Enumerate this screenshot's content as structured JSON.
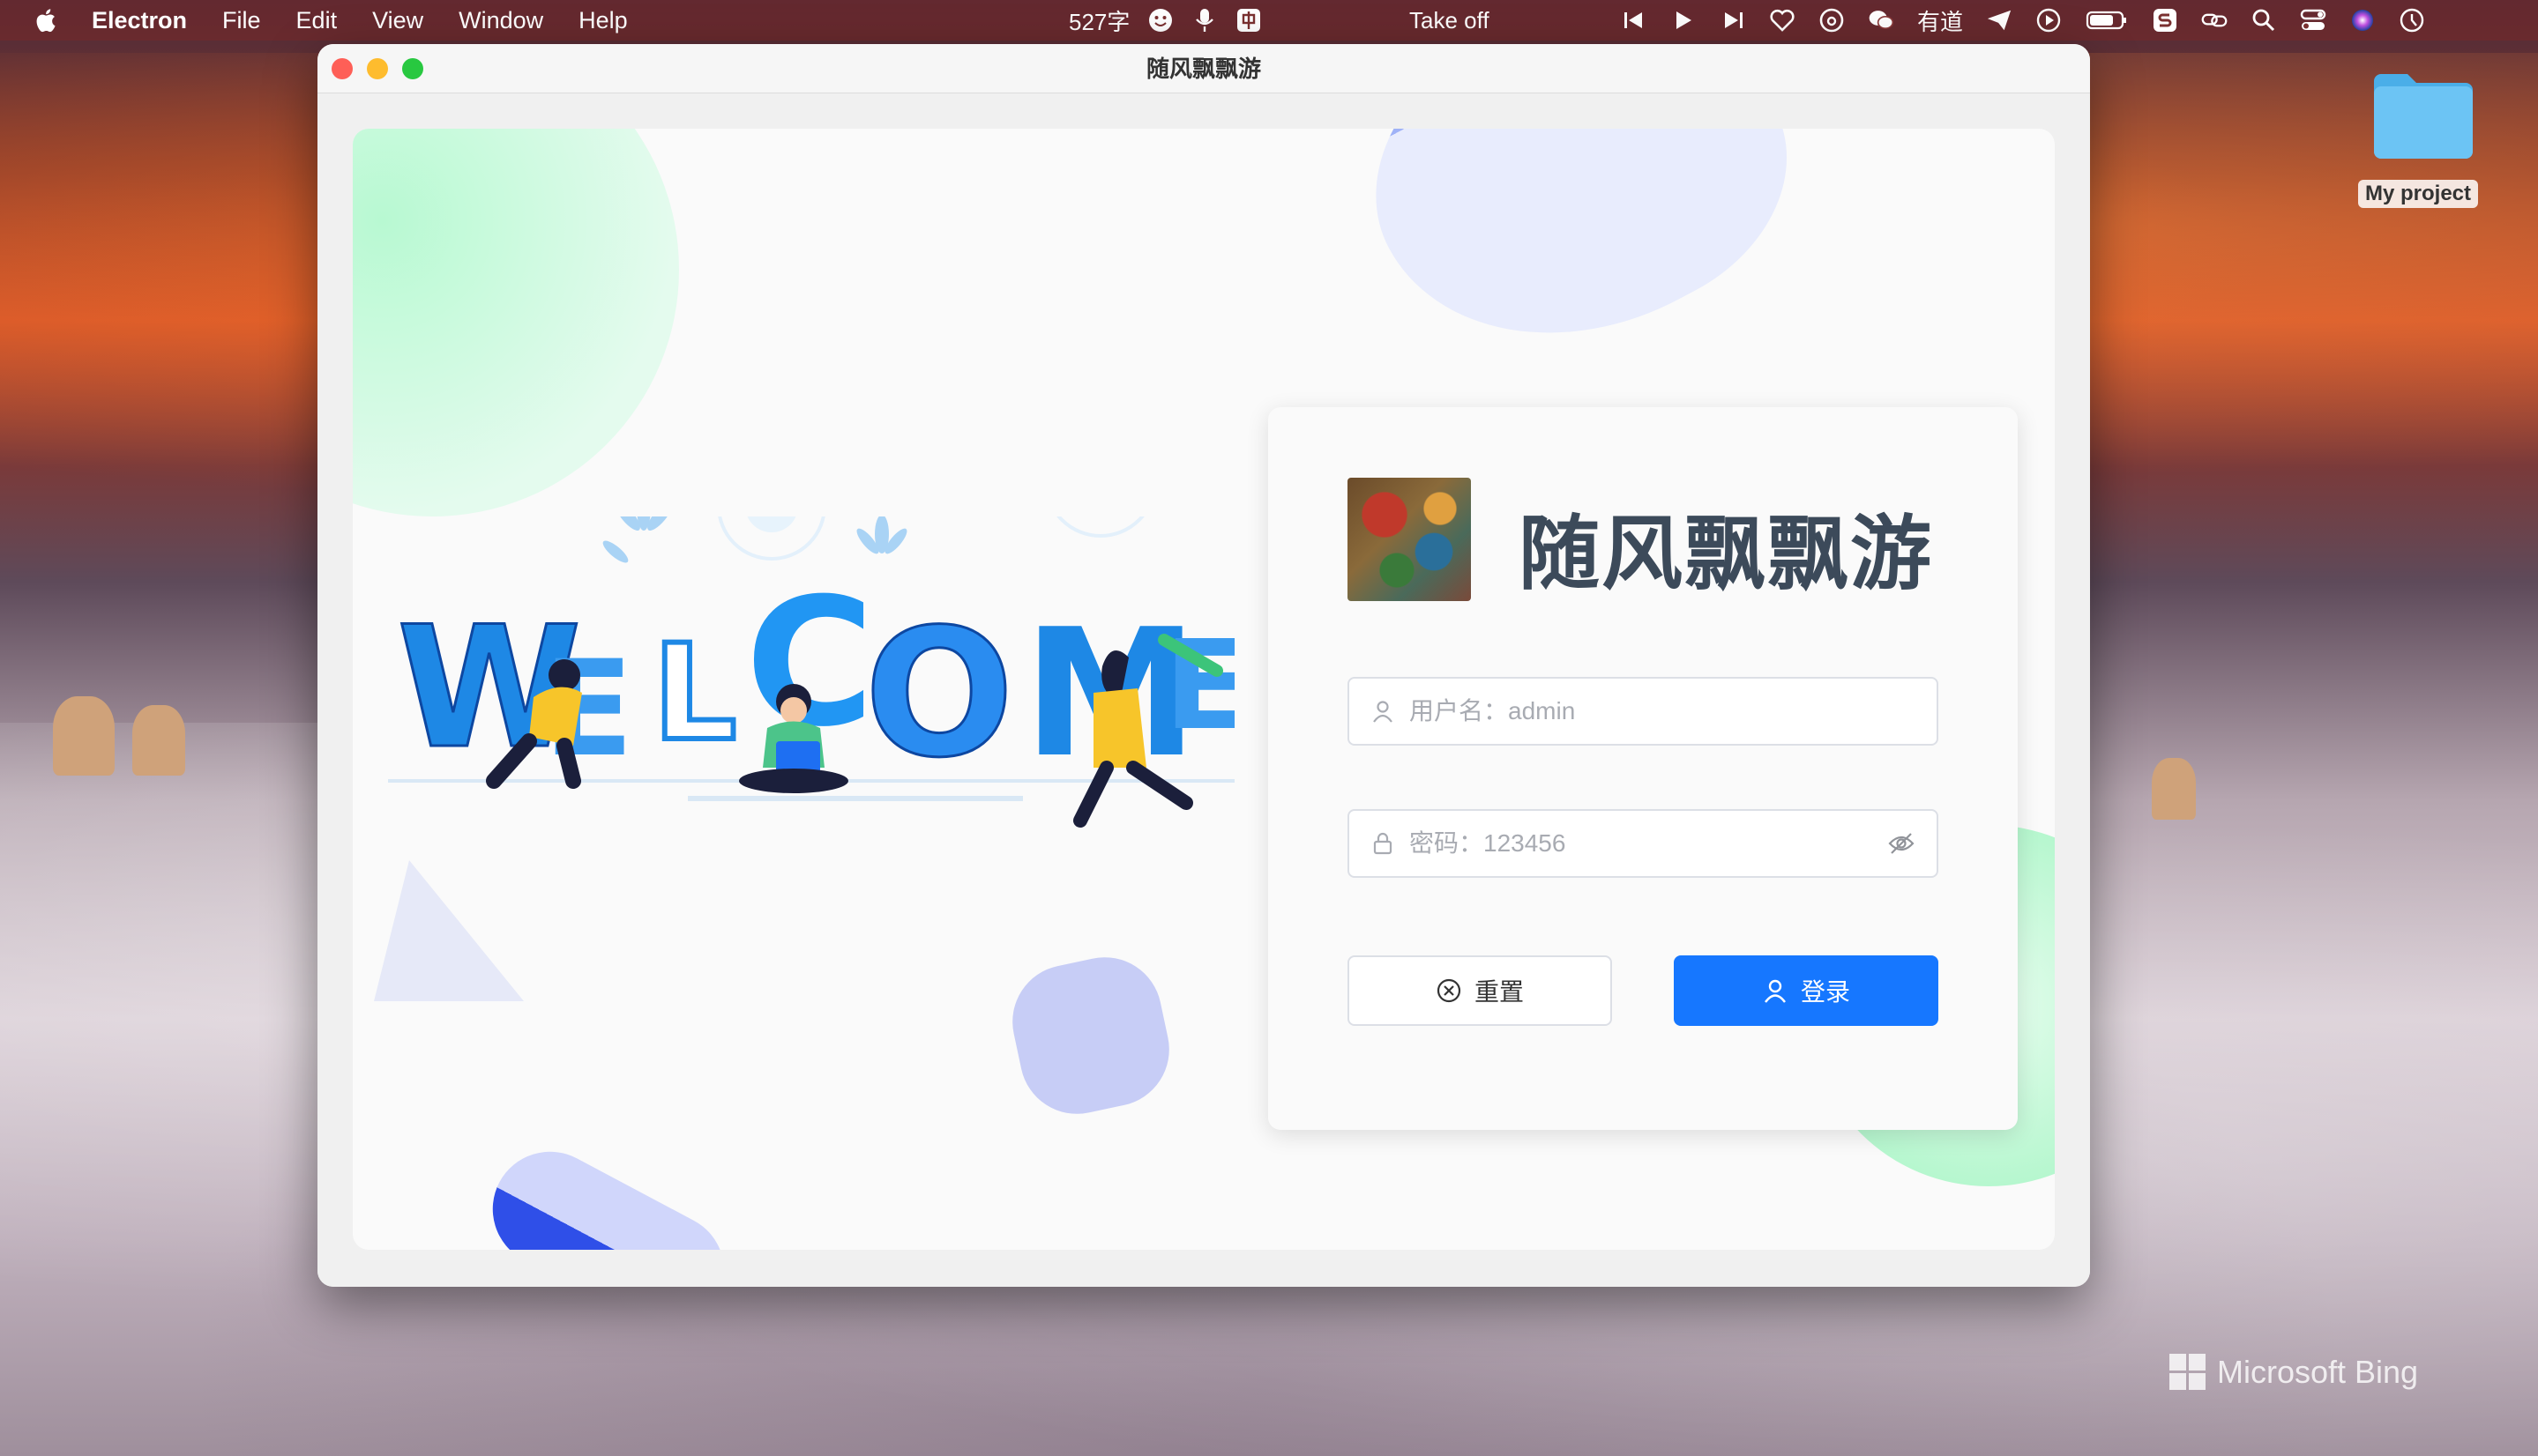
{
  "menubar": {
    "app": "Electron",
    "items": [
      "File",
      "Edit",
      "View",
      "Window",
      "Help"
    ],
    "word_count": "527字",
    "center_title": "Take off",
    "youdao": "有道"
  },
  "desktop": {
    "folder_label": "My project",
    "watermark": "Microsoft Bing"
  },
  "window": {
    "title": "随风飘飘游"
  },
  "login": {
    "app_name": "随风飘飘游",
    "username_placeholder": "用户名：admin",
    "password_placeholder": "密码：123456",
    "reset_label": "重置",
    "login_label": "登录"
  },
  "illustration": {
    "word": "WELCOME"
  },
  "colors": {
    "accent": "#1677ff",
    "blob_green": "#a8f5c8",
    "blob_blue": "#a9b8f5",
    "welcome_blue": "#1e88e5"
  }
}
